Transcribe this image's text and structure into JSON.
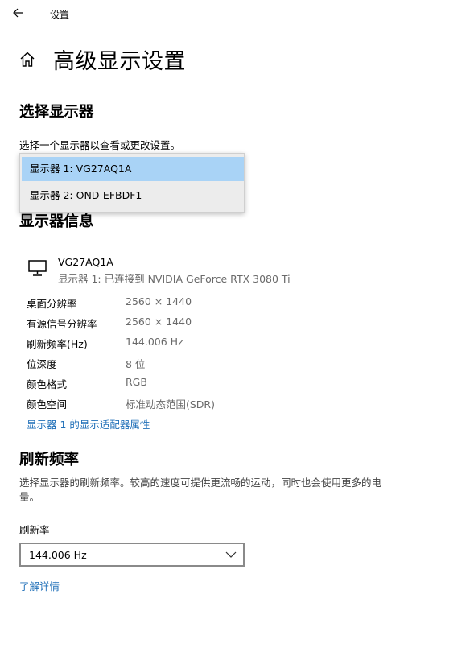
{
  "window": {
    "title": "设置"
  },
  "header": {
    "title": "高级显示设置"
  },
  "select_display": {
    "title": "选择显示器",
    "description": "选择一个显示器以查看或更改设置。",
    "options": [
      "显示器 1: VG27AQ1A",
      "显示器 2: OND-EFBDF1"
    ]
  },
  "display_info": {
    "title": "显示器信息",
    "monitor_name": "VG27AQ1A",
    "monitor_subtitle": "显示器 1: 已连接到 NVIDIA GeForce RTX 3080 Ti",
    "rows": [
      {
        "label": "桌面分辨率",
        "value": "2560 × 1440"
      },
      {
        "label": "有源信号分辨率",
        "value": "2560 × 1440"
      },
      {
        "label": "刷新频率(Hz)",
        "value": "144.006 Hz"
      },
      {
        "label": "位深度",
        "value": "8 位"
      },
      {
        "label": "颜色格式",
        "value": "RGB"
      },
      {
        "label": "颜色空间",
        "value": "标准动态范围(SDR)"
      }
    ],
    "adapter_link": "显示器 1 的显示适配器属性"
  },
  "refresh_rate": {
    "title": "刷新频率",
    "description": "选择显示器的刷新频率。较高的速度可提供更流畅的运动，同时也会使用更多的电量。",
    "field_label": "刷新率",
    "selected": "144.006 Hz",
    "learn_more": "了解详情"
  },
  "icons": {
    "back": "arrow-left-icon",
    "home": "home-icon",
    "monitor": "monitor-icon",
    "dropdown": "chevron-down-icon"
  },
  "colors": {
    "accent_link": "#1f6fb8",
    "selected_item": "#a9d3f6"
  }
}
